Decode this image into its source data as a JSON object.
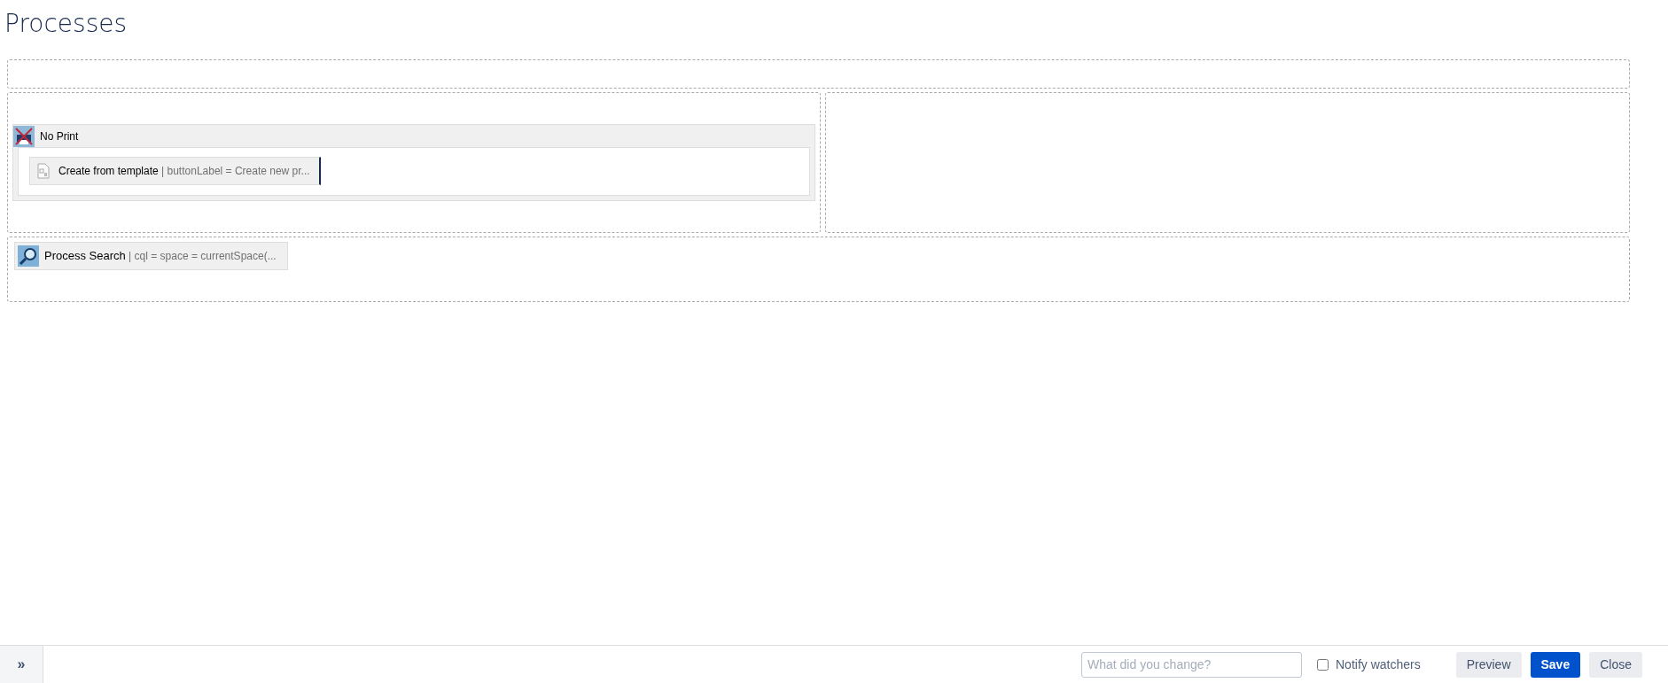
{
  "page_title": "Processes",
  "no_print": {
    "label": "No Print",
    "macro": {
      "name": "Create from template",
      "params": "| buttonLabel = Create new pr..."
    }
  },
  "process_search": {
    "name": "Process Search",
    "params": "| cql = space = currentSpace(..."
  },
  "footer": {
    "toggle": "»",
    "comment": {
      "placeholder": "What did you change?"
    },
    "notify": {
      "label": "Notify watchers",
      "checked": false
    },
    "buttons": [
      {
        "label": "Preview",
        "kind": "secondary"
      },
      {
        "label": "Save",
        "kind": "primary"
      },
      {
        "label": "Close",
        "kind": "secondary"
      }
    ]
  }
}
